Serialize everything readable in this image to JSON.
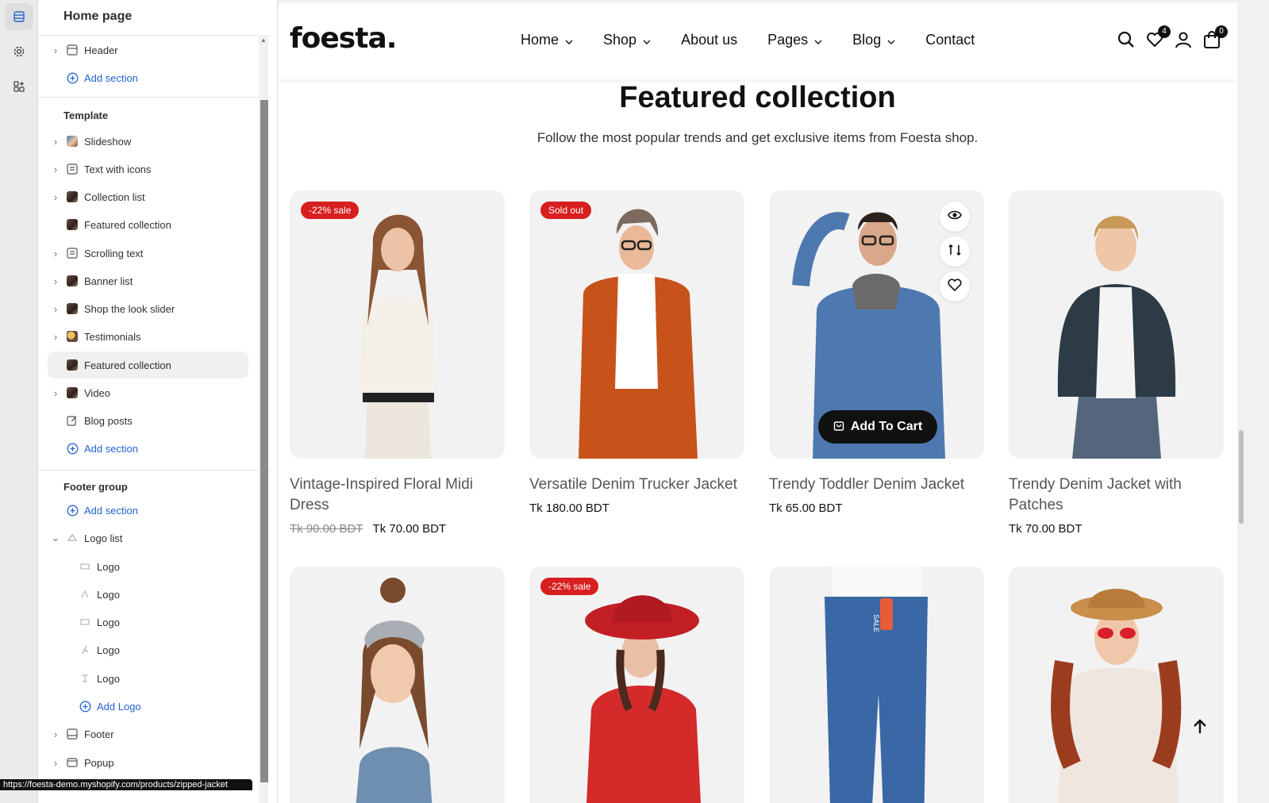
{
  "panel": {
    "title": "Home page",
    "header_item": "Header",
    "add_section": "Add section",
    "template_label": "Template",
    "template_items": [
      "Slideshow",
      "Text with icons",
      "Collection list",
      "Featured collection",
      "Scrolling text",
      "Banner list",
      "Shop the look slider",
      "Testimonials",
      "Featured collection",
      "Video",
      "Blog posts"
    ],
    "footer_group_label": "Footer group",
    "logo_list": "Logo list",
    "logo_items": [
      "Logo",
      "Logo",
      "Logo",
      "Logo",
      "Logo"
    ],
    "add_logo": "Add Logo",
    "footer": "Footer",
    "popup": "Popup",
    "status_url": "https://foesta-demo.myshopify.com/products/zipped-jacket"
  },
  "site": {
    "logo": "foesta.",
    "nav": [
      "Home",
      "Shop",
      "About us",
      "Pages",
      "Blog",
      "Contact"
    ],
    "wishlist_count": "4",
    "cart_count": "0"
  },
  "section": {
    "title": "Featured collection",
    "subtitle": "Follow the most popular trends and get exclusive items from Foesta shop."
  },
  "products": [
    {
      "badge": "-22% sale",
      "title": "Vintage-Inspired Floral Midi Dress",
      "old_price": "Tk 90.00 BDT",
      "price": "Tk 70.00 BDT"
    },
    {
      "badge": "Sold out",
      "title": "Versatile Denim Trucker Jacket",
      "old_price": "",
      "price": "Tk 180.00 BDT"
    },
    {
      "badge": "",
      "title": "Trendy Toddler Denim Jacket",
      "old_price": "",
      "price": "Tk 65.00 BDT",
      "cta": "Add To Cart"
    },
    {
      "badge": "",
      "title": "Trendy Denim Jacket with Patches",
      "old_price": "",
      "price": "Tk 70.00 BDT"
    },
    {
      "badge": "",
      "title": "",
      "old_price": "",
      "price": ""
    },
    {
      "badge": "-22% sale",
      "title": "",
      "old_price": "",
      "price": ""
    },
    {
      "badge": "",
      "title": "",
      "old_price": "",
      "price": "",
      "tag": "SALE"
    },
    {
      "badge": "",
      "title": "",
      "old_price": "",
      "price": ""
    }
  ],
  "colors": {
    "sale_badge": "#d71f1f",
    "link_blue": "#2463d1",
    "accent_dark": "#111111"
  },
  "icons": [
    "sections-icon",
    "settings-icon",
    "apps-icon",
    "search-icon",
    "heart-icon",
    "user-icon",
    "bag-icon",
    "eye-icon",
    "compare-icon",
    "arrow-up-icon"
  ]
}
